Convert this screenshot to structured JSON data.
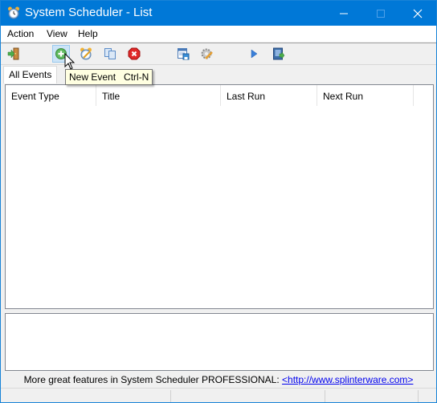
{
  "window": {
    "title": "System Scheduler - List",
    "app_icon": "alarm-clock-icon",
    "controls": [
      "minimize",
      "maximize",
      "close"
    ]
  },
  "menu": {
    "items": [
      {
        "label": "Action"
      },
      {
        "label": "View"
      },
      {
        "label": "Help"
      }
    ]
  },
  "toolbar": {
    "buttons": [
      {
        "icon": "exit-door-icon",
        "tooltip": ""
      },
      {
        "icon": "add-event-icon",
        "tooltip": "New Event  Ctrl-N",
        "hovered": true
      },
      {
        "icon": "edit-event-icon",
        "tooltip": ""
      },
      {
        "icon": "copy-icon",
        "tooltip": ""
      },
      {
        "icon": "delete-icon",
        "tooltip": ""
      },
      {
        "icon": "save-list-icon",
        "tooltip": ""
      },
      {
        "icon": "settings-icon",
        "tooltip": ""
      },
      {
        "icon": "run-icon",
        "tooltip": ""
      },
      {
        "icon": "export-icon",
        "tooltip": ""
      }
    ]
  },
  "tooltip": {
    "text": "New Event   Ctrl-N"
  },
  "tabs": [
    {
      "label": "All Events",
      "active": true
    }
  ],
  "list": {
    "columns": [
      "Event Type",
      "Title",
      "Last Run",
      "Next Run"
    ],
    "rows": []
  },
  "promo": {
    "text": "More great features in System Scheduler PROFESSIONAL: ",
    "link": "<http://www.splinterware.com>"
  },
  "colors": {
    "titlebar": "#0078d7",
    "link": "#0000ee",
    "tooltip_bg": "#ffffe1"
  }
}
